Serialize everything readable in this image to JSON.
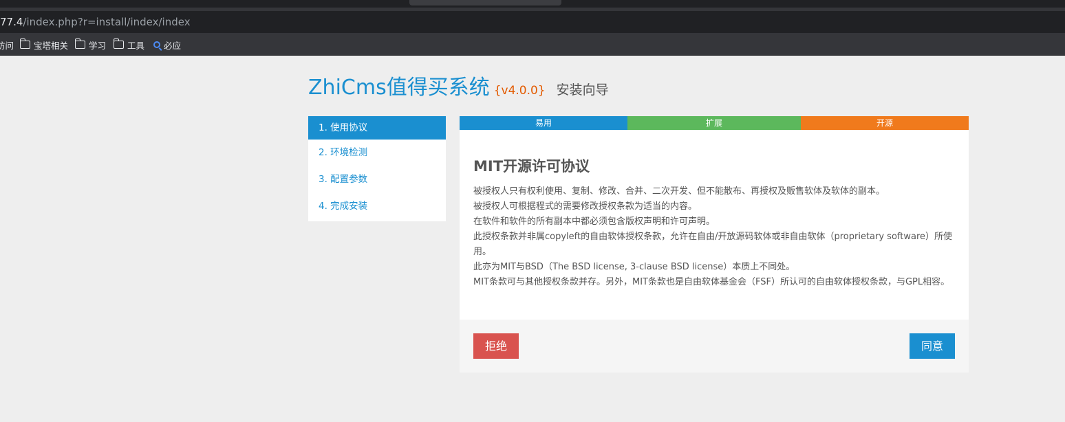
{
  "browser": {
    "url_host": "77.4",
    "url_path": "/index.php?r=install/index/index",
    "bookmarks": [
      {
        "label": "访问",
        "icon": "none"
      },
      {
        "label": "宝塔相关",
        "icon": "folder-icon"
      },
      {
        "label": "学习",
        "icon": "folder-icon"
      },
      {
        "label": "工具",
        "icon": "folder-icon"
      },
      {
        "label": "必应",
        "icon": "search-icon"
      }
    ]
  },
  "header": {
    "brand": "ZhiCms值得买系统",
    "version": "{v4.0.0}",
    "wizard": "安装向导"
  },
  "steps": [
    {
      "label": "1. 使用协议",
      "active": true
    },
    {
      "label": "2. 环境检测",
      "active": false
    },
    {
      "label": "3. 配置参数",
      "active": false
    },
    {
      "label": "4. 完成安装",
      "active": false
    }
  ],
  "tags": {
    "easy": "易用",
    "extend": "扩展",
    "open": "开源"
  },
  "license": {
    "title": "MIT开源许可协议",
    "lines": [
      "被授权人只有权利使用、复制、修改、合并、二次开发、但不能散布、再授权及贩售软体及软体的副本。",
      "被授权人可根据程式的需要修改授权条款为适当的内容。",
      "在软件和软件的所有副本中都必须包含版权声明和许可声明。",
      "此授权条款并非属copyleft的自由软体授权条款，允许在自由/开放源码软体或非自由软体（proprietary software）所使用。",
      "此亦为MIT与BSD（The BSD license, 3-clause BSD license）本质上不同处。",
      "MIT条款可与其他授权条款并存。另外，MIT条款也是自由软体基金会（FSF）所认可的自由软体授权条款，与GPL相容。"
    ]
  },
  "buttons": {
    "refuse": "拒绝",
    "agree": "同意"
  },
  "colors": {
    "primary": "#1a8fd0",
    "success": "#5cb85c",
    "warning": "#f07a1c",
    "danger": "#d9534f",
    "version": "#e35b00"
  }
}
